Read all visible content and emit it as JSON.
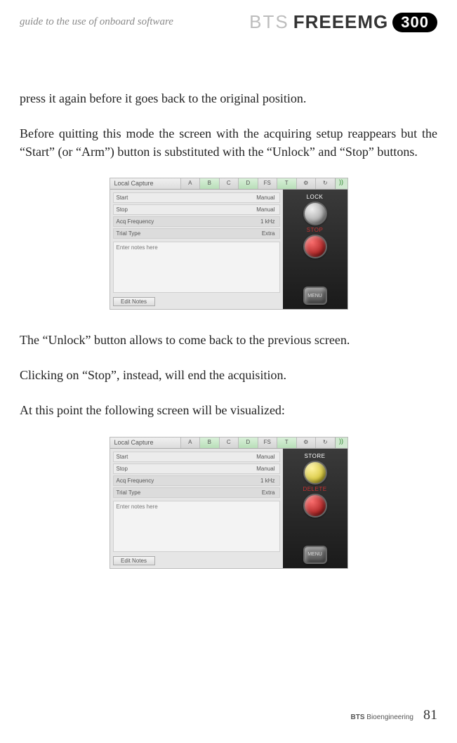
{
  "header": {
    "section_title": "guide to the use of onboard software",
    "brand_bts": "BTS",
    "brand_freeemg": "FREEEMG",
    "brand_badge": "300"
  },
  "paragraphs": {
    "p1": "press it again before it goes back to the original position.",
    "p2": "Before quitting this mode the screen with the acquiring setup reappears but the “Start” (or “Arm”) button is substituted with the “Unlock” and “Stop” buttons.",
    "p3": "The  “Unlock” button allows to come back to the previous screen.",
    "p4": " Clicking on “Stop”, instead, will end the acquisition.",
    "p5": "At this point the following screen will be visualized:"
  },
  "uishot1": {
    "title": "Local Capture",
    "tabs": [
      "A",
      "B",
      "C",
      "D",
      "FS",
      "T",
      "⚙",
      "↻"
    ],
    "rows": {
      "start_l": "Start",
      "start_v": "Manual",
      "stop_l": "Stop",
      "stop_v": "Manual",
      "freq_l": "Acq Frequency",
      "freq_v": "1 kHz",
      "trial_l": "Trial Type",
      "trial_v": "Extra"
    },
    "notes_placeholder": "Enter notes here",
    "edit_notes": "Edit Notes",
    "btn1_label": "LOCK",
    "btn2_label": "STOP",
    "menu_label": "MENU"
  },
  "uishot2": {
    "title": "Local Capture",
    "tabs": [
      "A",
      "B",
      "C",
      "D",
      "FS",
      "T",
      "⚙",
      "↻"
    ],
    "rows": {
      "start_l": "Start",
      "start_v": "Manual",
      "stop_l": "Stop",
      "stop_v": "Manual",
      "freq_l": "Acq Frequency",
      "freq_v": "1 kHz",
      "trial_l": "Trial Type",
      "trial_v": "Extra"
    },
    "notes_placeholder": "Enter notes here",
    "edit_notes": "Edit Notes",
    "btn1_label": "STORE",
    "btn2_label": "DELETE",
    "menu_label": "MENU"
  },
  "footer": {
    "company_bold": "BTS",
    "company_rest": " Bioengineering",
    "page": "81"
  }
}
